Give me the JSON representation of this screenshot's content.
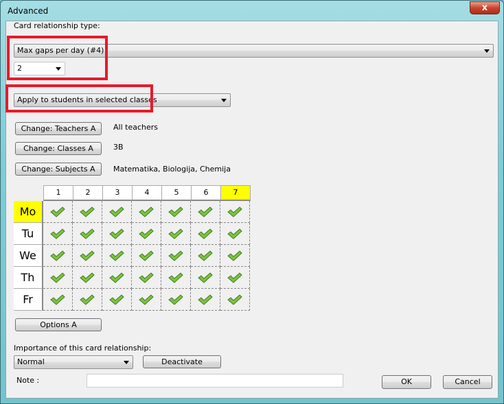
{
  "window": {
    "title": "Advanced",
    "close_label": "x"
  },
  "type_label": "Card relationship type:",
  "type_value": "Max gaps per day (#4)",
  "gaps_value": "2",
  "apply_value": "Apply to students in selected classes",
  "filters": [
    {
      "button": "Change: Teachers A",
      "value": "All teachers"
    },
    {
      "button": "Change: Classes A",
      "value": "3B"
    },
    {
      "button": "Change: Subjects A",
      "value": "Matematika, Biologija, Chemija"
    }
  ],
  "grid": {
    "periods": [
      "1",
      "2",
      "3",
      "4",
      "5",
      "6",
      "7"
    ],
    "days": [
      "Mo",
      "Tu",
      "We",
      "Th",
      "Fr"
    ],
    "highlight_color": "#ffff00",
    "highlighted_period": "7",
    "highlighted_day": "Mo",
    "checked": [
      [
        true,
        true,
        true,
        true,
        true,
        true,
        true
      ],
      [
        true,
        true,
        true,
        true,
        true,
        true,
        true
      ],
      [
        true,
        true,
        true,
        true,
        true,
        true,
        true
      ],
      [
        true,
        true,
        true,
        true,
        true,
        true,
        true
      ],
      [
        true,
        true,
        true,
        true,
        true,
        true,
        true
      ]
    ]
  },
  "options_label": "Options A",
  "importance_label": "Importance of this card relationship:",
  "importance_value": "Normal",
  "deactivate_label": "Deactivate",
  "note_label": "Note :",
  "note_value": "",
  "ok_label": "OK",
  "cancel_label": "Cancel",
  "highlight_box_color": "#e8192c"
}
